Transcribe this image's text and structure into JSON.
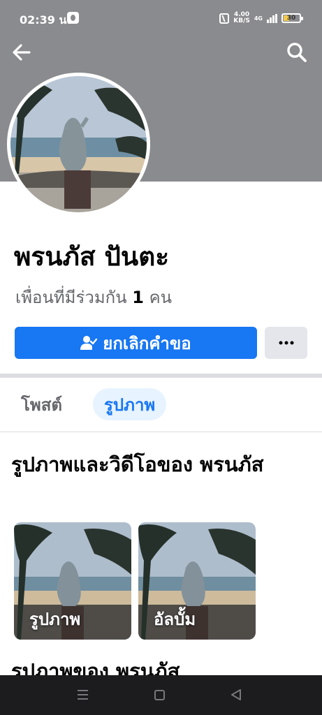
{
  "status_bar": {
    "time": "02:39 น.",
    "net_speed_top": "4.00",
    "net_speed_bottom": "KB/S",
    "network": "4G",
    "battery": "30"
  },
  "header": {
    "back_icon": "arrow-left-icon",
    "search_icon": "search-icon"
  },
  "profile": {
    "name": "พรนภัส ปันตะ",
    "mutual_prefix": "เพื่อนที่มีร่วมกัน",
    "mutual_count": "1",
    "mutual_suffix": "คน"
  },
  "actions": {
    "cancel_request_label": "ยกเลิกคำขอ",
    "cancel_request_icon": "person-check-icon",
    "more_icon": "more-dots-icon"
  },
  "tabs": [
    {
      "label": "โพสต์",
      "active": false
    },
    {
      "label": "รูปภาพ",
      "active": true
    }
  ],
  "photos_section": {
    "title": "รูปภาพและวิดีโอของ พรนภัส",
    "albums": [
      {
        "label": "รูปภาพ"
      },
      {
        "label": "อัลบั้ม"
      }
    ]
  },
  "photos_of_section": {
    "title": "รูปภาพของ พรนภัส"
  },
  "colors": {
    "accent": "#1877f2",
    "accent_light": "#e7f3ff",
    "cover": "#8a8b8e",
    "secondary_text": "#65676b",
    "nav_bar": "#1c1c1e"
  }
}
